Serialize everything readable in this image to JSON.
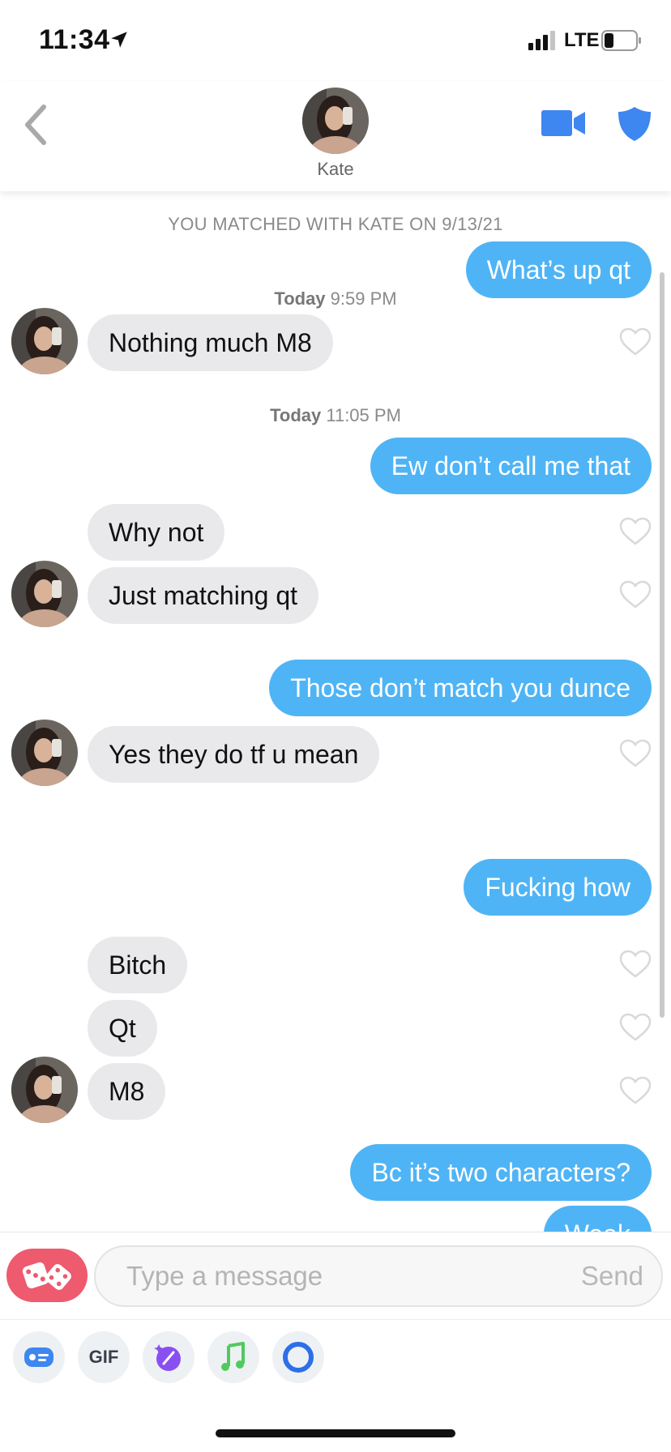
{
  "status_bar": {
    "time": "11:34",
    "network": "LTE"
  },
  "header": {
    "contact_name": "Kate"
  },
  "chat": {
    "match_note": "YOU MATCHED WITH KATE ON 9/13/21",
    "timestamps": [
      {
        "day": "Today",
        "time": "9:59 PM"
      },
      {
        "day": "Today",
        "time": "11:05 PM"
      }
    ],
    "messages": [
      {
        "from": "me",
        "text": "What’s up qt"
      },
      {
        "from": "kate",
        "text": "Nothing much M8"
      },
      {
        "from": "me",
        "text": "Ew don’t call me that"
      },
      {
        "from": "kate",
        "text": "Why not"
      },
      {
        "from": "kate",
        "text": "Just matching qt"
      },
      {
        "from": "me",
        "text": "Those don’t match you dunce"
      },
      {
        "from": "kate",
        "text": "Yes they do tf u mean"
      },
      {
        "from": "me",
        "text": "Fucking how"
      },
      {
        "from": "kate",
        "text": "Bitch"
      },
      {
        "from": "kate",
        "text": "Qt"
      },
      {
        "from": "kate",
        "text": "M8"
      },
      {
        "from": "me",
        "text": "Bc it’s two characters?"
      },
      {
        "from": "me",
        "text": "Weak"
      }
    ]
  },
  "composer": {
    "placeholder": "Type a message",
    "send_label": "Send"
  },
  "tools": {
    "gif_label": "GIF"
  },
  "colors": {
    "outgoing": "#4fb4f5",
    "incoming": "#e9e9eb",
    "accent_blue": "#3e86f0",
    "dice": "#ee5a6e"
  }
}
